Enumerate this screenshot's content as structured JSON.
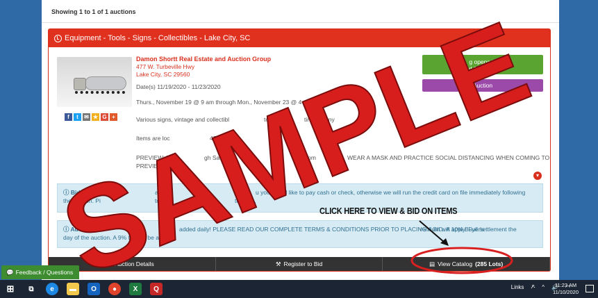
{
  "listing": {
    "showing": "Showing 1 to 1 of 1 auctions",
    "title": "Equipment - Tools - Signs - Collectibles - Lake City, SC",
    "company": "Damon Shortt Real Estate and Auction Group",
    "address1": "477 W. Turbeville Hwy",
    "address2": "Lake City, SC 29560",
    "dates": "Date(s) 11/19/2020 - 11/23/2020",
    "schedule": "Thurs., November 19 @ 9 am through Mon., November 23 @ 4",
    "desc": "Various signs, vintage and collectibl",
    "desc_b": "tool",
    "desc_c": "tir",
    "desc_d": "any",
    "location": "Items are loc",
    "location_b": "477 W. Tur",
    "location_c": "ake",
    "preview_a": "PREVIEW: T",
    "preview_b": "gh Satur",
    "preview_c": "5 pm",
    "preview_d": "WEAR A MASK AND PRACTICE SOCIAL DISTANCING WHEN COMING TO",
    "preview_e": "PREVIEW T",
    "bidding_opens": "g opens in",
    "bidding_time": "d 21h 37m",
    "auction_btn": "Auction",
    "bidding_label": "Bidding",
    "bidding_a": "a cal",
    "bidding_b": "of",
    "bidding_c": "u you would like to pay cash or check, otherwise we will run the credit card on file immediately following",
    "bidding_d": "the auction. Pi",
    "bidding_e": "to",
    "bidding_f": "14 M",
    "bidding_g": "to 5 pm.",
    "notice_label": "Auction Not",
    "notice_a": "added daily! PLEASE READ OUR COMPLETE TERMS & CONDITIONS PRIOR TO PLACING A BID. A 10% Buyer's",
    "notice_b": "remium will apply. Full settlement the",
    "notice_c": "day of the auction. A 9% tax will be applied."
  },
  "footer": {
    "details": "Auction Details",
    "register": "Register to Bid",
    "catalog": "View Catalog",
    "lots": "(285 Lots)"
  },
  "overlay": {
    "callout": "CLICK HERE TO VIEW & BID ON ITEMS",
    "watermark": "SAMPLE"
  },
  "feedback": "Feedback / Questions",
  "taskbar": {
    "links": "Links",
    "time": "11:23 AM",
    "date": "11/10/2020"
  },
  "colors": {
    "brand_red": "#e0301e",
    "bid_green": "#5aa532",
    "purple": "#9b4aa9",
    "info_blue": "#d7ebf5"
  }
}
